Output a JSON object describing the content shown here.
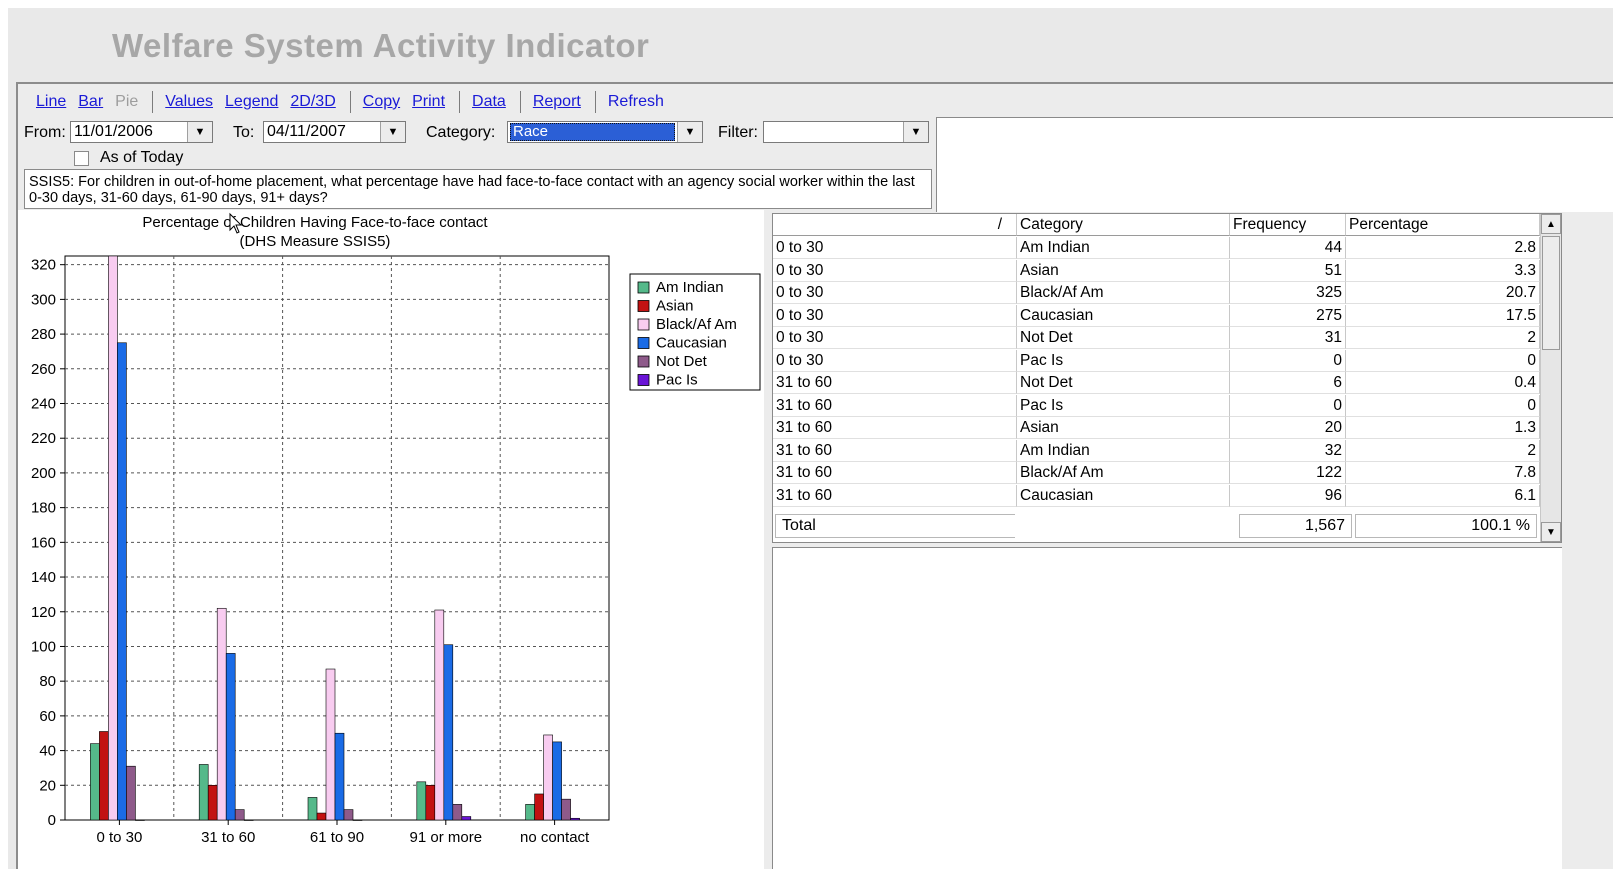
{
  "app": {
    "title": "Welfare System Activity Indicator"
  },
  "menu": {
    "line": "Line",
    "bar": "Bar",
    "pie": "Pie",
    "values": "Values",
    "legend": "Legend",
    "dim": "2D/3D",
    "copy": "Copy",
    "print": "Print",
    "data": "Data",
    "report": "Report",
    "refresh": "Refresh"
  },
  "filters": {
    "from_label": "From:",
    "from_value": "11/01/2006",
    "to_label": "To:",
    "to_value": "04/11/2007",
    "category_label": "Category:",
    "category_value": "Race",
    "filter_label": "Filter:",
    "filter_value": "",
    "as_of_today_label": "As of Today",
    "as_of_today_checked": false
  },
  "question": "SSIS5: For children in out-of-home placement, what percentage have had face-to-face contact with an agency social worker within the last 0-30 days, 31-60 days, 61-90 days, 91+ days?",
  "chart_data": {
    "type": "bar",
    "title": "Percentage of Children Having Face-to-face contact",
    "subtitle": "(DHS Measure SSIS5)",
    "categories": [
      "0 to 30",
      "31 to 60",
      "61 to 90",
      "91 or more",
      "no contact"
    ],
    "ylim": [
      0,
      325
    ],
    "yticks": [
      0,
      20,
      40,
      60,
      80,
      100,
      120,
      140,
      160,
      180,
      200,
      220,
      240,
      260,
      280,
      300,
      320
    ],
    "grid": true,
    "legend_position": "right",
    "series": [
      {
        "name": "Am Indian",
        "color": "#55b98a",
        "values": [
          44,
          32,
          13,
          22,
          9
        ]
      },
      {
        "name": "Asian",
        "color": "#c21212",
        "values": [
          51,
          20,
          4,
          20,
          15
        ]
      },
      {
        "name": "Black/Af Am",
        "color": "#f8ccf0",
        "values": [
          325,
          122,
          87,
          121,
          49
        ]
      },
      {
        "name": "Caucasian",
        "color": "#1a6be6",
        "values": [
          275,
          96,
          50,
          101,
          45
        ]
      },
      {
        "name": "Not Det",
        "color": "#8e5a8a",
        "values": [
          31,
          6,
          6,
          9,
          12
        ]
      },
      {
        "name": "Pac Is",
        "color": "#6a14d6",
        "values": [
          0,
          0,
          0,
          2,
          1
        ]
      }
    ]
  },
  "table": {
    "columns": [
      "",
      "Category",
      "Frequency",
      "Percentage"
    ],
    "sort_indicator": "/",
    "rows": [
      [
        "0 to 30",
        "Am Indian",
        "44",
        "2.8"
      ],
      [
        "0 to 30",
        "Asian",
        "51",
        "3.3"
      ],
      [
        "0 to 30",
        "Black/Af Am",
        "325",
        "20.7"
      ],
      [
        "0 to 30",
        "Caucasian",
        "275",
        "17.5"
      ],
      [
        "0 to 30",
        "Not Det",
        "31",
        "2"
      ],
      [
        "0 to 30",
        "Pac Is",
        "0",
        "0"
      ],
      [
        "31 to 60",
        "Not Det",
        "6",
        "0.4"
      ],
      [
        "31 to 60",
        "Pac Is",
        "0",
        "0"
      ],
      [
        "31 to 60",
        "Asian",
        "20",
        "1.3"
      ],
      [
        "31 to 60",
        "Am Indian",
        "32",
        "2"
      ],
      [
        "31 to 60",
        "Black/Af Am",
        "122",
        "7.8"
      ],
      [
        "31 to 60",
        "Caucasian",
        "96",
        "6.1"
      ]
    ],
    "total_label": "Total",
    "total_frequency": "1,567",
    "total_percentage": "100.1 %"
  },
  "icons": {
    "dropdown": "chevron-down-icon",
    "cursor": "mouse-pointer-icon"
  }
}
